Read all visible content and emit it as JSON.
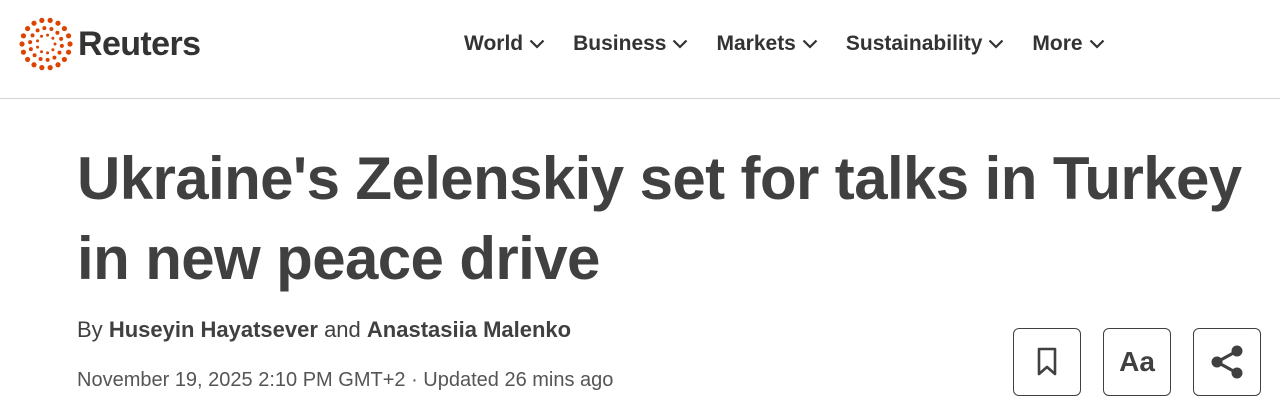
{
  "brand": {
    "name": "Reuters",
    "accent": "#dc4300"
  },
  "nav": {
    "items": [
      {
        "label": "World"
      },
      {
        "label": "Business"
      },
      {
        "label": "Markets"
      },
      {
        "label": "Sustainability"
      },
      {
        "label": "More"
      }
    ]
  },
  "article": {
    "headline": "Ukraine's Zelenskiy set for talks in Turkey in new peace drive",
    "byline": {
      "prefix": "By",
      "author1": "Huseyin Hayatsever",
      "conjunction": "and",
      "author2": "Anastasiia Malenko"
    },
    "date": "November 19, 2025 2:10 PM GMT+2",
    "separator": "·",
    "updated": "Updated 26 mins ago"
  },
  "tools": {
    "bookmark_icon": "bookmark-icon",
    "text_size_label": "Aa",
    "share_icon": "share-icon"
  }
}
